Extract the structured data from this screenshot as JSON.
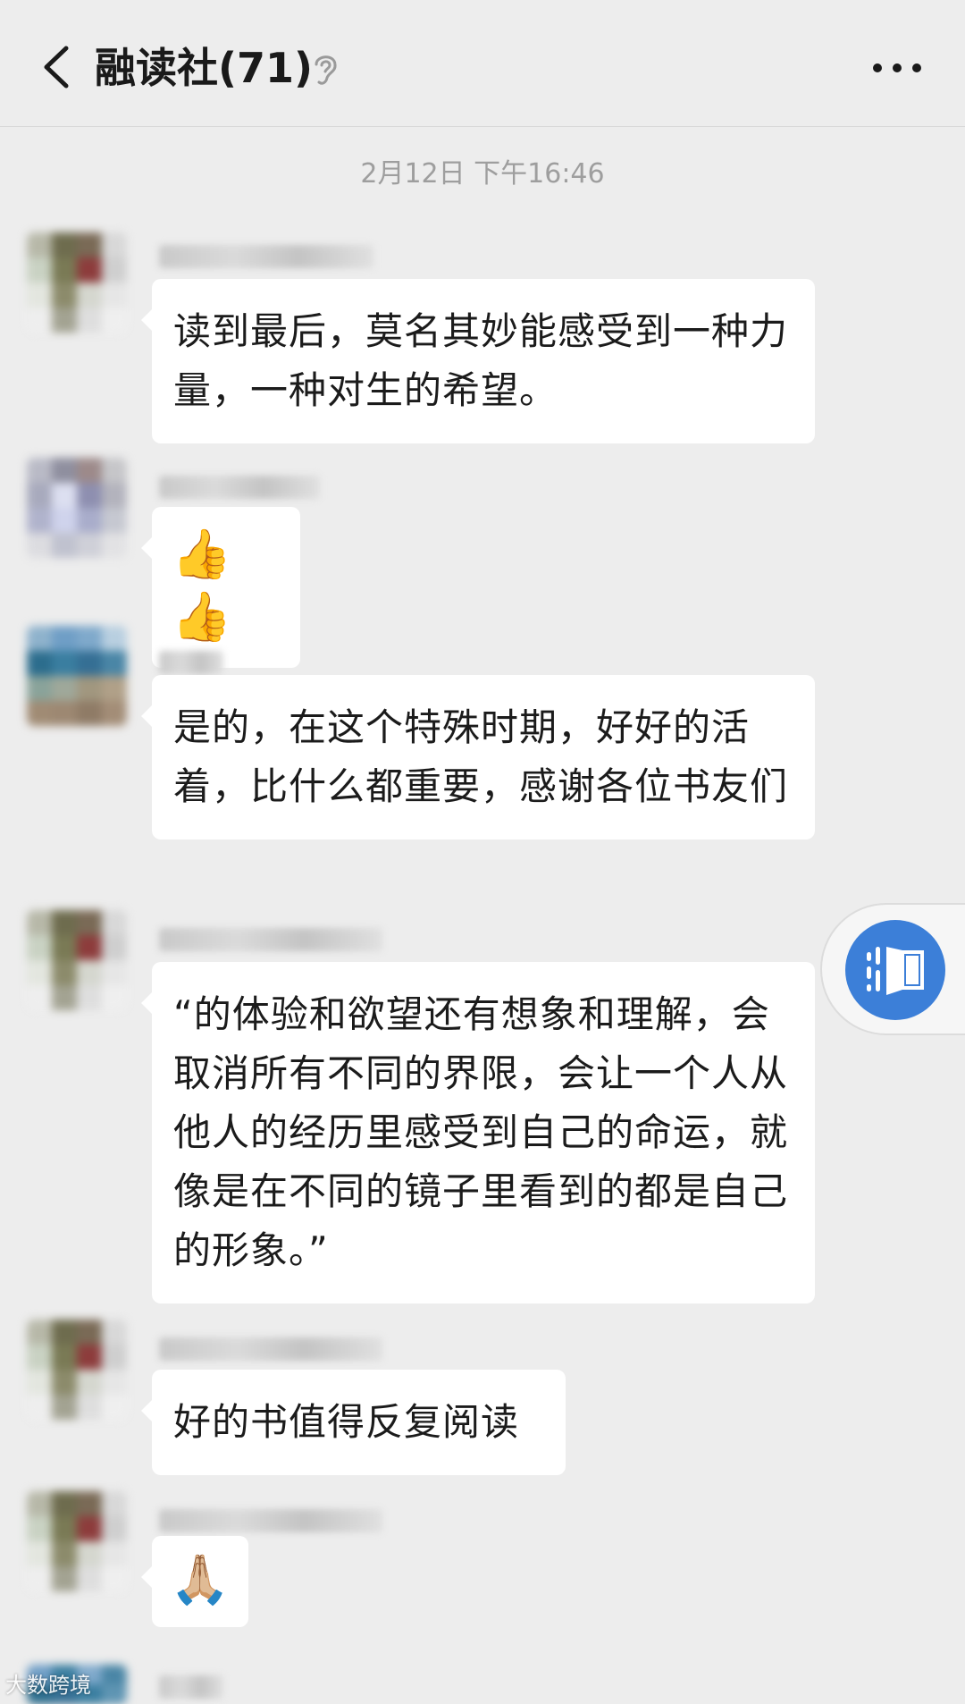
{
  "header": {
    "title": "融读社(71)",
    "back_icon": "chevron-left-icon",
    "mute_icon": "ear-icon",
    "more_icon": "more-dots-icon"
  },
  "timestamp": "2月12日 下午16:46",
  "messages": [
    {
      "sender": "",
      "text": "读到最后，莫名其妙能感受到一种力量，一种对生的希望。"
    },
    {
      "sender": "",
      "text": "👍👍"
    },
    {
      "sender": "",
      "text": "是的，在这个特殊时期，好好的活着，比什么都重要，感谢各位书友们"
    },
    {
      "sender": "",
      "text": "“的体验和欲望还有想象和理解，会取消所有不同的界限，会让一个人从他人的经历里感受到自己的命运，就像是在不同的镜子里看到的都是自己的形象。”"
    },
    {
      "sender": "",
      "text": "好的书值得反复阅读"
    },
    {
      "sender": "",
      "text": "🙏🏼"
    }
  ],
  "floating_button": {
    "icon": "reader-icon",
    "color": "#3c7fd8"
  },
  "watermark": "大数跨境",
  "colors": {
    "background": "#ededed",
    "bubble": "#ffffff",
    "accent": "#3c7fd8"
  }
}
